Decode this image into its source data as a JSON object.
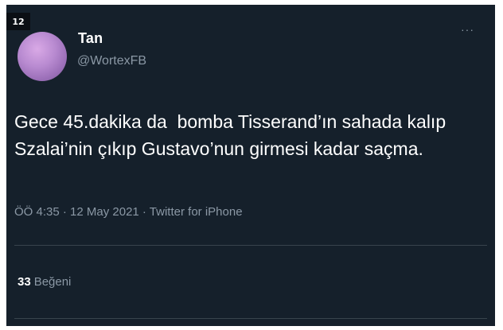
{
  "badge": {
    "number": "12"
  },
  "tweet": {
    "display_name": "Tan",
    "username": "@WortexFB",
    "more_icon": "more-horizontal-icon",
    "text": "Gece 45.dakika da  bomba Tisserand’ın sahada kalıp\nSzalai’nin çıkıp Gustavo’nun girmesi kadar saçma.",
    "meta": "ÖÖ 4:35 · 12 May 2021 · Twitter for iPhone",
    "likes_count": "33",
    "likes_label": "Beğeni"
  },
  "colors": {
    "background": "#15202b",
    "text_primary": "#ffffff",
    "text_secondary": "#8b98a5",
    "divider": "#38444d"
  }
}
